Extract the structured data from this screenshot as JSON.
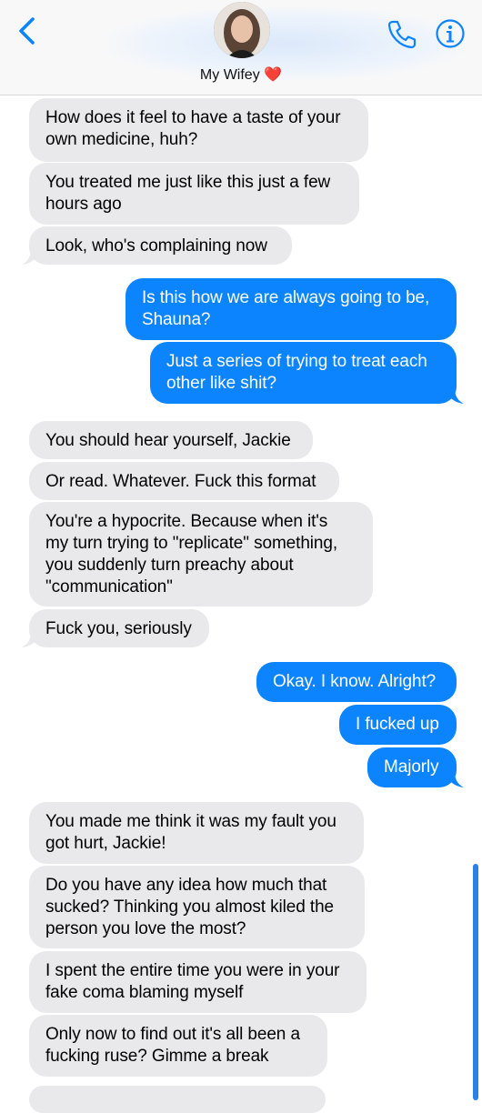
{
  "header": {
    "contact_name": "My Wifey ❤️",
    "icons": [
      "chevron-left-icon",
      "avatar",
      "phone-icon",
      "info-icon"
    ],
    "accent_color": "#0b84fe"
  },
  "messages": [
    {
      "side": "in",
      "text": "How does it feel to have a taste of your\nown medicine, huh?"
    },
    {
      "side": "in",
      "text": "You treated me just like this just a few\nhours ago"
    },
    {
      "side": "in",
      "text": "Look, who's complaining now"
    },
    {
      "side": "out",
      "text": "Is this how we are always going to be,\nShauna?"
    },
    {
      "side": "out",
      "text": "Just a series of trying to treat each\nother like shit?"
    },
    {
      "side": "in",
      "text": "You should hear yourself, Jackie"
    },
    {
      "side": "in",
      "text": "Or read. Whatever. Fuck this format"
    },
    {
      "side": "in",
      "text": "You're a hypocrite. Because when it's\nmy turn trying to \"replicate\" something,\nyou suddenly turn preachy about\n\"communication\""
    },
    {
      "side": "in",
      "text": "Fuck you, seriously"
    },
    {
      "side": "out",
      "text": "Okay. I know. Alright?"
    },
    {
      "side": "out",
      "text": "I fucked up"
    },
    {
      "side": "out",
      "text": "Majorly"
    },
    {
      "side": "in",
      "text": "You made me think it was my fault you\ngot hurt, Jackie!"
    },
    {
      "side": "in",
      "text": "Do you have any idea how much that\nsucked? Thinking you almost kiled the\nperson you love the most?"
    },
    {
      "side": "in",
      "text": "I spent the entire time you were in your\nfake coma blaming myself"
    },
    {
      "side": "in",
      "text": "Only now to find out it's all been a\nfucking ruse? Gimme a break"
    }
  ]
}
